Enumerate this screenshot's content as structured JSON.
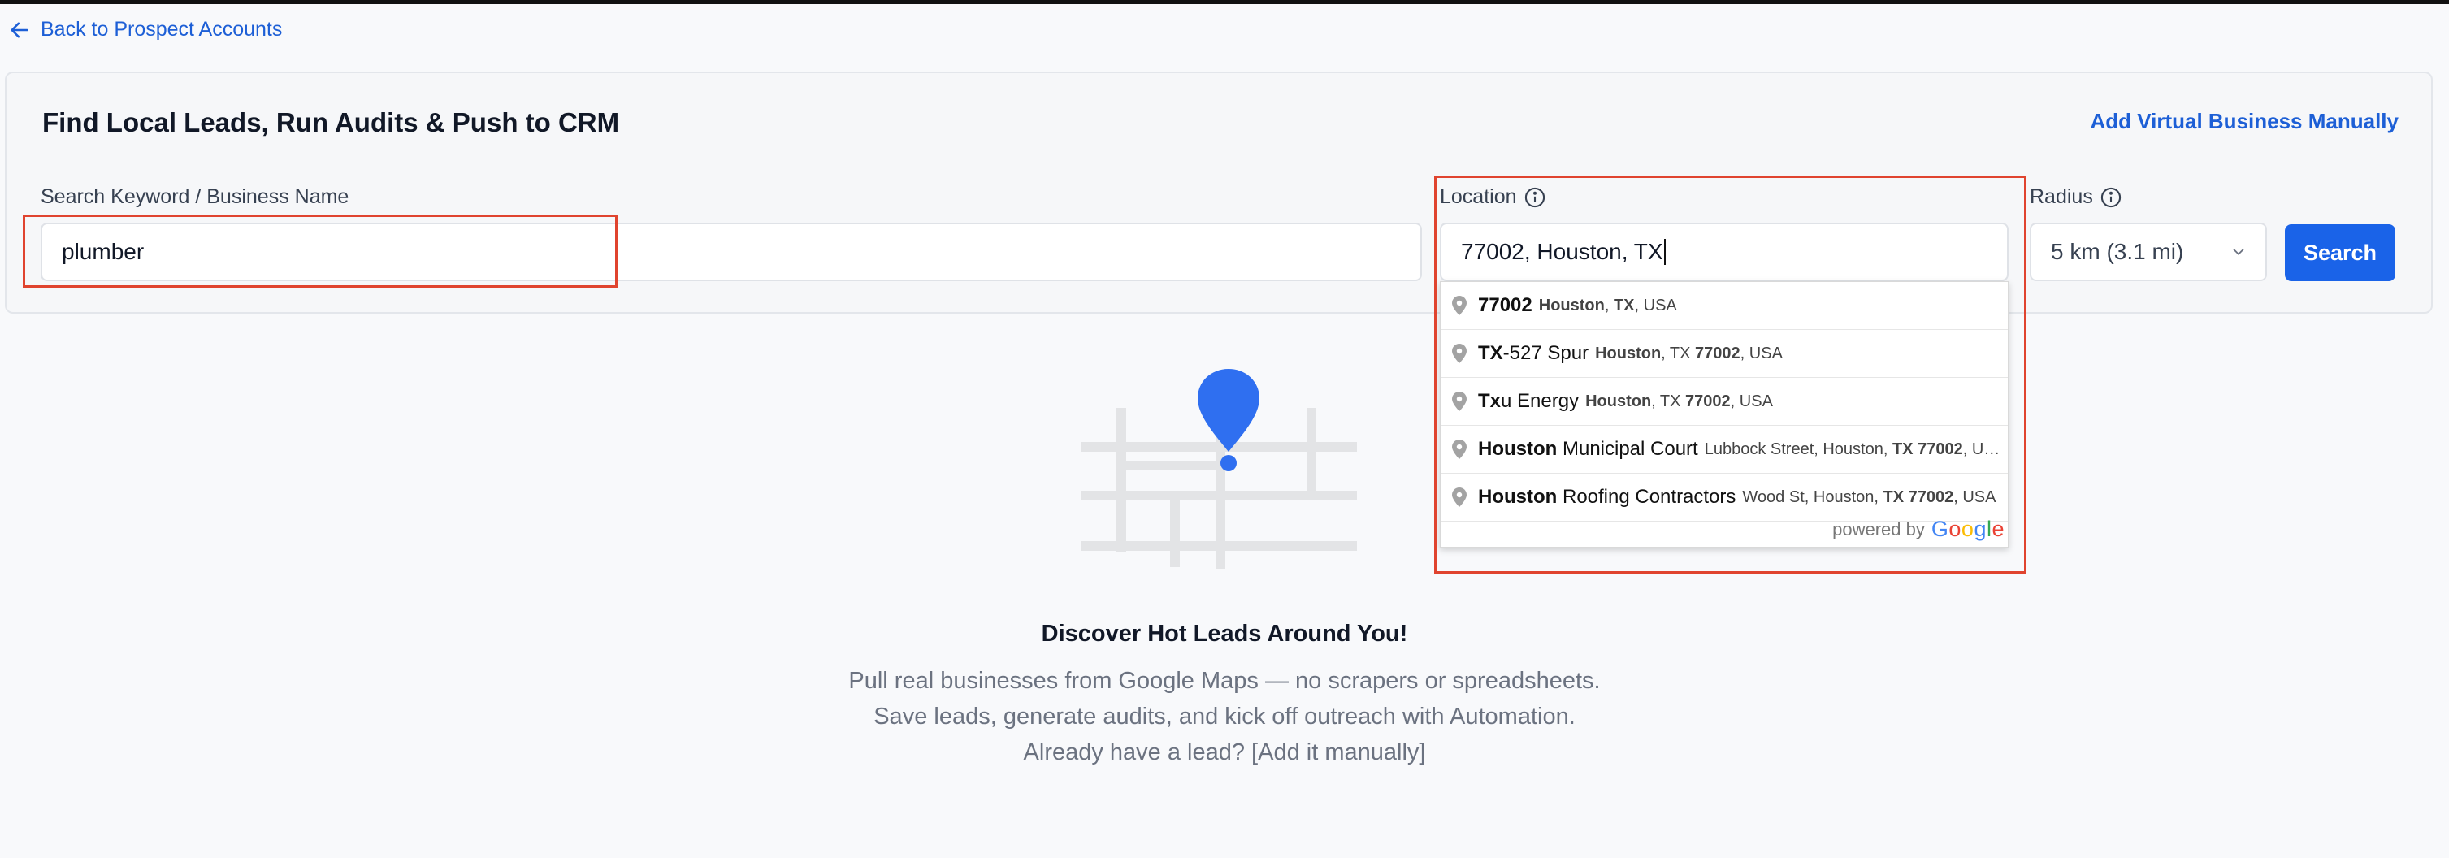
{
  "nav": {
    "back_label": "Back to Prospect Accounts"
  },
  "card": {
    "title": "Find Local Leads, Run Audits & Push to CRM",
    "add_manual_label": "Add Virtual Business Manually"
  },
  "keyword": {
    "label": "Search Keyword / Business Name",
    "value": "plumber"
  },
  "location": {
    "label": "Location",
    "value": "77002, Houston, TX"
  },
  "radius": {
    "label": "Radius",
    "value": "5 km (3.1 mi)"
  },
  "search_button": "Search",
  "suggestions": [
    {
      "main_bold": "77002",
      "main_rest": "",
      "sec": [
        {
          "t": "Houston",
          "b": true
        },
        {
          "t": ", ",
          "b": false
        },
        {
          "t": "TX",
          "b": true
        },
        {
          "t": ", USA",
          "b": false
        }
      ]
    },
    {
      "main_bold": "TX",
      "main_rest": "-527 Spur",
      "sec": [
        {
          "t": "Houston",
          "b": true
        },
        {
          "t": ", TX ",
          "b": false
        },
        {
          "t": "77002",
          "b": true
        },
        {
          "t": ", USA",
          "b": false
        }
      ]
    },
    {
      "main_bold": "Tx",
      "main_rest": "u Energy",
      "sec": [
        {
          "t": "Houston",
          "b": true
        },
        {
          "t": ", TX ",
          "b": false
        },
        {
          "t": "77002",
          "b": true
        },
        {
          "t": ", USA",
          "b": false
        }
      ]
    },
    {
      "main_bold": "Houston",
      "main_rest": " Municipal Court",
      "sec": [
        {
          "t": "Lubbock Street, Houston, ",
          "b": false
        },
        {
          "t": "TX 77002",
          "b": true
        },
        {
          "t": ", U…",
          "b": false
        }
      ]
    },
    {
      "main_bold": "Houston",
      "main_rest": " Roofing Contractors",
      "sec": [
        {
          "t": "Wood St, Houston, ",
          "b": false
        },
        {
          "t": "TX 77002",
          "b": true
        },
        {
          "t": ", USA",
          "b": false
        }
      ]
    }
  ],
  "powered_by": {
    "prefix": "powered by",
    "brand": "Google"
  },
  "empty_state": {
    "title": "Discover Hot Leads Around You!",
    "line1": "Pull real businesses from Google Maps — no scrapers or spreadsheets.",
    "line2": "Save leads, generate audits, and kick off outreach with Automation.",
    "line3": "Already have a lead? [Add it manually]"
  },
  "icons": {
    "back": "arrow-left-icon",
    "info": "info-icon",
    "chevron": "chevron-down-icon",
    "pin": "map-pin-icon"
  },
  "colors": {
    "accent": "#1a63e8",
    "link": "#1d5fd6",
    "highlight": "#e0442f",
    "map_pin": "#2f6ff0"
  }
}
